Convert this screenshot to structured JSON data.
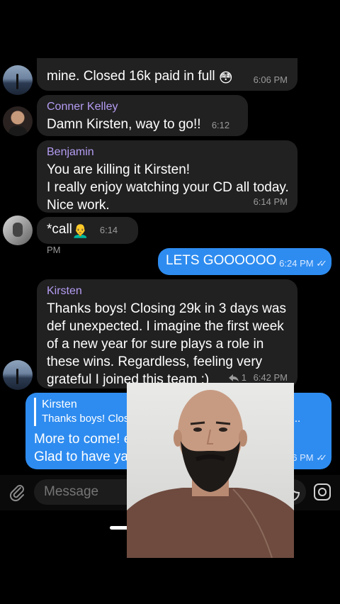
{
  "messages": [
    {
      "text": "mine. Closed 16k paid in full",
      "emoji": "😳",
      "time": "6:06 PM"
    },
    {
      "sender": "Conner Kelley",
      "text": "Damn Kirsten, way to go!!",
      "time": "6:12 PM"
    },
    {
      "sender": "Benjamin",
      "lines": [
        "You are killing it Kirsten!",
        "I really enjoy watching your CD all today.",
        "Nice work."
      ],
      "time": "6:14 PM"
    },
    {
      "text": "*call",
      "emoji": "👨‍🦲",
      "time": "6:14 PM"
    },
    {
      "text": "LETS GOOOOOO",
      "time": "6:24 PM",
      "checks": "✓✓"
    },
    {
      "sender": "Kirsten",
      "lines": [
        "Thanks boys! Closing 29k in 3 days was",
        "def unexpected. I imagine the first week",
        "of a new year for sure plays a role in",
        "these wins. Regardless, feeling very",
        "grateful I joined this team :)"
      ],
      "reaction": "1",
      "time": "6:42 PM"
    },
    {
      "reply_name": "Kirsten",
      "reply_text": "Thanks boys! Closing 29k in 3 days was def unexpec...",
      "lines": [
        "More to come! excellent",
        "Glad to have ya :)"
      ],
      "time": "6:46 PM",
      "checks": "✓✓"
    }
  ],
  "input": {
    "placeholder": "Message"
  },
  "icons": {
    "attach": "paperclip-icon",
    "sticker": "sticker-icon",
    "camera": "camera-icon",
    "reply": "reply-arrow-icon"
  },
  "colors": {
    "background": "#000000",
    "incoming": "#212121",
    "outgoing": "#2e8cf0",
    "sender_name": "#b49cf2"
  }
}
